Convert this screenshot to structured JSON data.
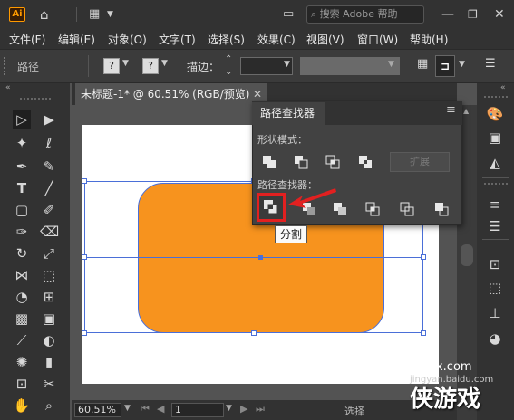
{
  "app": {
    "logo": "Ai"
  },
  "titlebar": {
    "search_placeholder": "搜索 Adobe 帮助"
  },
  "menu": [
    "文件(F)",
    "编辑(E)",
    "对象(O)",
    "文字(T)",
    "选择(S)",
    "效果(C)",
    "视图(V)",
    "窗口(W)",
    "帮助(H)"
  ],
  "control_bar": {
    "selection_label": "路径",
    "q1": "?",
    "q2": "?",
    "stroke_label": "描边："
  },
  "document": {
    "tab_title": "未标题-1* @ 60.51% (RGB/预览)"
  },
  "status_bar": {
    "zoom": "60.51%",
    "page": "1",
    "tool": "选择"
  },
  "pathfinder": {
    "title": "路径查找器",
    "shape_modes_label": "形状模式：",
    "expand_label": "扩展",
    "pathfinders_label": "路径查找器：",
    "tooltip": "分割"
  },
  "colors": {
    "shape_fill": "#f7931e",
    "selection": "#4a6fd8",
    "highlight": "#e22020"
  },
  "watermark": {
    "domain": "xiayx.com",
    "sub": "jingyan.baidu.com",
    "brand": "侠游戏"
  }
}
